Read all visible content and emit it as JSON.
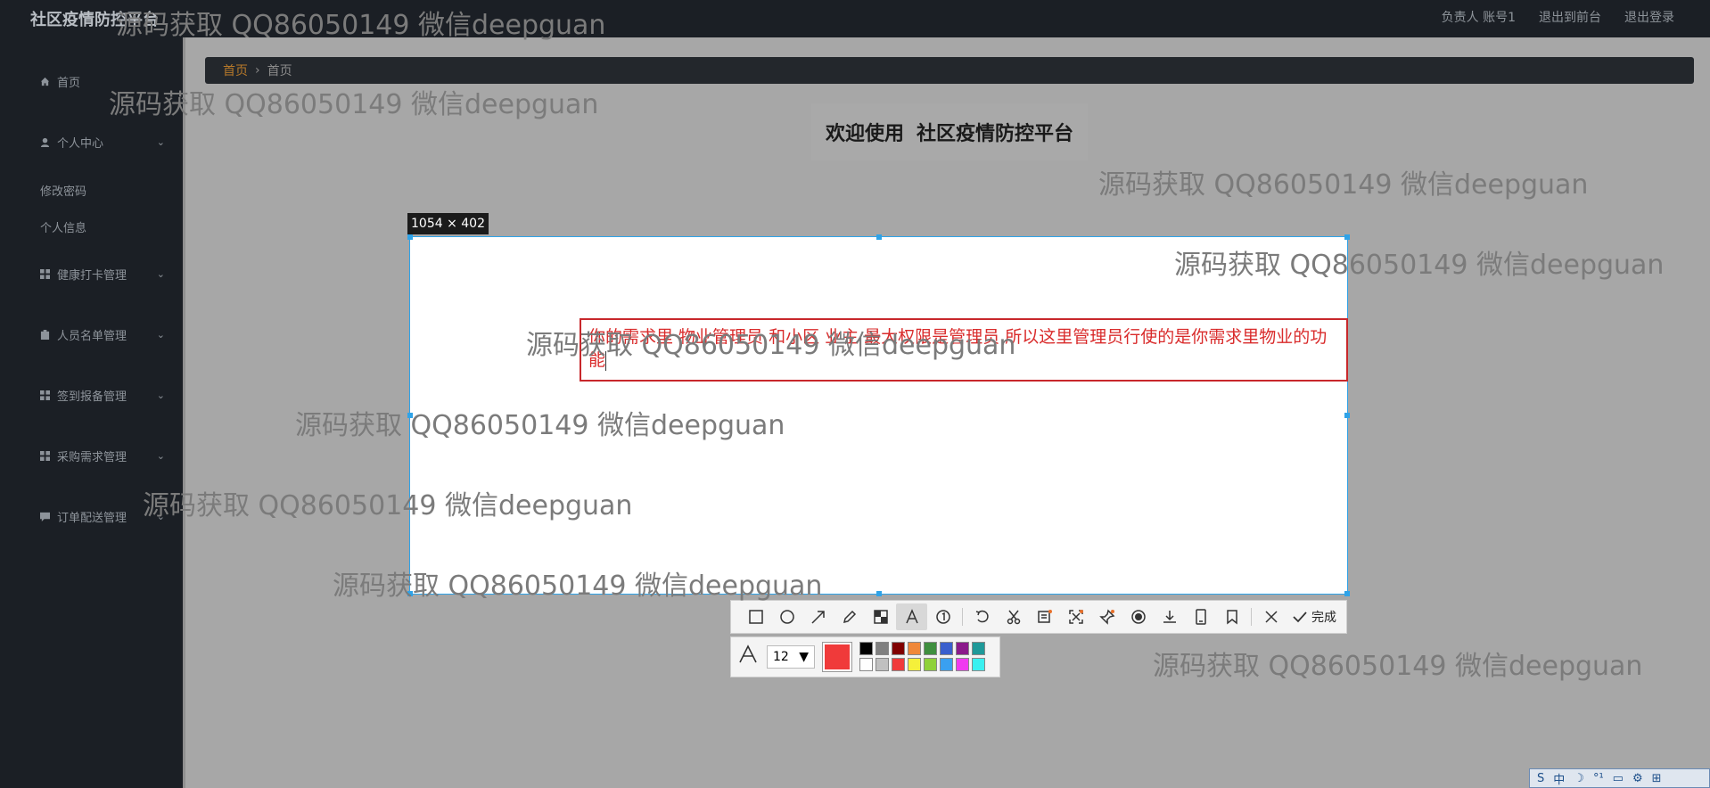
{
  "header": {
    "app_title": "社区疫情防控平台",
    "links": [
      "负责人 账号1",
      "退出到前台",
      "退出登录"
    ]
  },
  "sidebar": {
    "items": [
      {
        "label": "首页",
        "icon": "home-icon"
      },
      {
        "label": "个人中心",
        "icon": "user-icon"
      },
      {
        "label": "健康打卡管理",
        "icon": "grid-icon"
      },
      {
        "label": "人员名单管理",
        "icon": "clipboard-icon"
      },
      {
        "label": "签到报备管理",
        "icon": "grid-icon"
      },
      {
        "label": "采购需求管理",
        "icon": "grid-icon"
      },
      {
        "label": "订单配送管理",
        "icon": "comment-icon"
      }
    ],
    "subitems": [
      "修改密码",
      "个人信息"
    ]
  },
  "breadcrumb": {
    "current": "首页",
    "page": "首页"
  },
  "welcome": {
    "prefix": "欢迎使用",
    "name": "社区疫情防控平台"
  },
  "screenshot_tool": {
    "dimensions": "1054 × 402",
    "annotation_text": "你的需求里 物业管理员 和小区 业主 最大权限是管理员 所以这里管理员行使的是你需求里物业的功能",
    "font_size": "12",
    "done_label": "完成",
    "selected_color": "#f03a3a",
    "palette": [
      "#000000",
      "#808080",
      "#800000",
      "#f0883a",
      "#3f8f3f",
      "#3a5fcd",
      "#8b1a8b",
      "#1f9999",
      "#ffffff",
      "#c0c0c0",
      "#f03a3a",
      "#f5f03a",
      "#8fd13a",
      "#3aa0f0",
      "#f03af0",
      "#3af0f0"
    ]
  },
  "watermark": "源码获取 QQ86050149 微信deepguan",
  "tray": {
    "items": [
      "S",
      "中",
      "☽",
      "°¹",
      "▭",
      "⚙",
      "⊞"
    ]
  }
}
